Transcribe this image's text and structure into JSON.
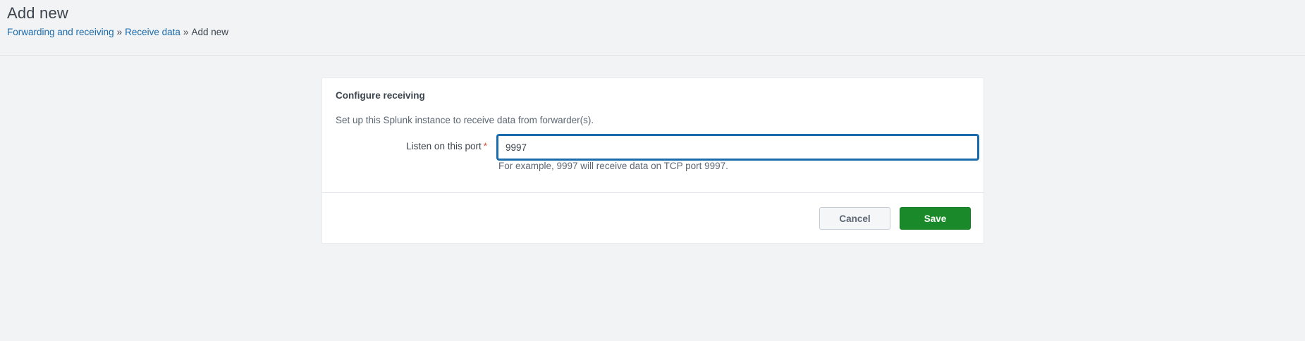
{
  "header": {
    "title": "Add new",
    "breadcrumb": [
      {
        "label": "Forwarding and receiving"
      },
      {
        "label": "Receive data"
      },
      {
        "label": "Add new"
      }
    ],
    "separator": "»"
  },
  "panel": {
    "title": "Configure receiving",
    "description": "Set up this Splunk instance to receive data from forwarder(s).",
    "port_field": {
      "label": "Listen on this port",
      "required_marker": "*",
      "value": "9997",
      "help": "For example, 9997 will receive data on TCP port 9997."
    }
  },
  "actions": {
    "cancel_label": "Cancel",
    "save_label": "Save"
  },
  "colors": {
    "link": "#1a6bac",
    "primary_button": "#1a8929",
    "focus_border": "#1a6bac"
  }
}
